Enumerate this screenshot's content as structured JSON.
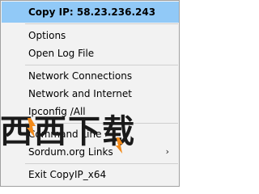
{
  "menu": {
    "items": [
      {
        "label": "Copy IP: 58.23.236.243"
      },
      {
        "label": "Options"
      },
      {
        "label": "Open Log File"
      },
      {
        "label": "Network Connections"
      },
      {
        "label": "Network and Internet"
      },
      {
        "label": "Ipconfig /All"
      },
      {
        "label": "Command Line"
      },
      {
        "label": "Sordum.org Links",
        "submenu_arrow": "›"
      },
      {
        "label": "Exit CopyIP_x64"
      }
    ]
  },
  "watermark": {
    "text": "西西下载"
  },
  "colors": {
    "highlight": "#91c9f7",
    "menu_bg": "#f2f2f2",
    "flame_orange": "#f28a1a"
  }
}
